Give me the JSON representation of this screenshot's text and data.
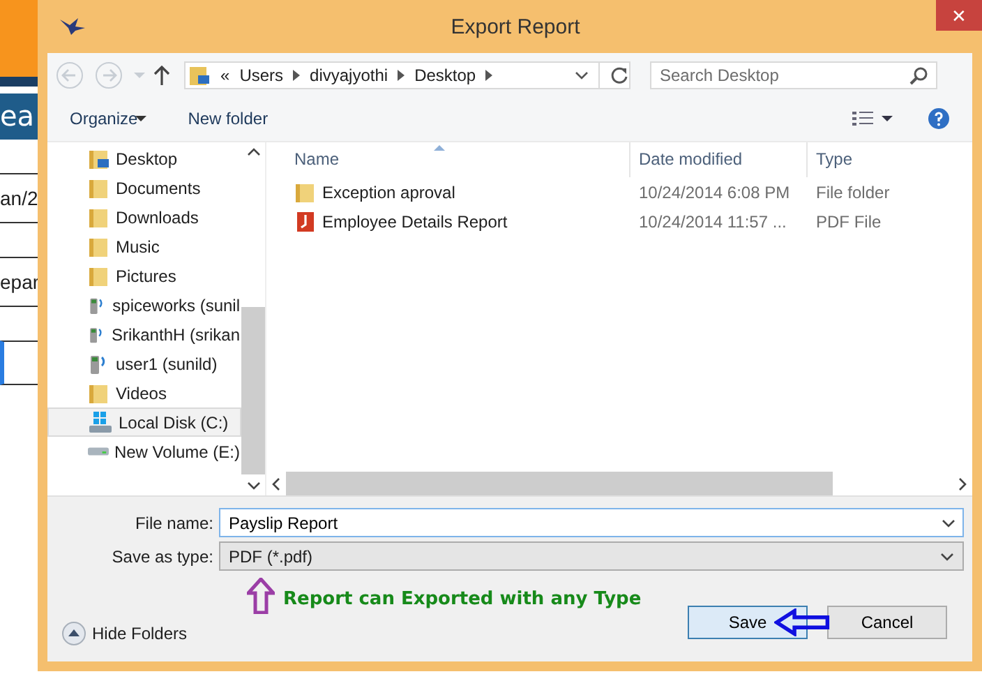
{
  "background_page": {
    "button_fragment": "ea",
    "field_fragments": [
      "an/2",
      "epar"
    ]
  },
  "window": {
    "title": "Export Report",
    "close": "✕"
  },
  "address": {
    "overflow": "«",
    "path": [
      "Users",
      "divyajyothi",
      "Desktop"
    ]
  },
  "search": {
    "placeholder": "Search Desktop"
  },
  "toolbar": {
    "organize": "Organize",
    "new_folder": "New folder"
  },
  "nav_tree": [
    {
      "label": "Desktop",
      "kind": "desktop",
      "selected": false
    },
    {
      "label": "Documents",
      "kind": "folder",
      "selected": false
    },
    {
      "label": "Downloads",
      "kind": "folder",
      "selected": false
    },
    {
      "label": "Music",
      "kind": "folder",
      "selected": false
    },
    {
      "label": "Pictures",
      "kind": "folder",
      "selected": false
    },
    {
      "label": "spiceworks (sunil",
      "kind": "network",
      "selected": false
    },
    {
      "label": "SrikanthH (srikan",
      "kind": "network",
      "selected": false
    },
    {
      "label": "user1 (sunild)",
      "kind": "network",
      "selected": false
    },
    {
      "label": "Videos",
      "kind": "folder",
      "selected": false
    },
    {
      "label": "Local Disk (C:)",
      "kind": "system-drive",
      "selected": true
    },
    {
      "label": "New Volume (E:)",
      "kind": "drive",
      "selected": false
    }
  ],
  "columns": [
    "Name",
    "Date modified",
    "Type"
  ],
  "files": [
    {
      "name": "Exception aproval",
      "kind": "folder",
      "date": "10/24/2014 6:08 PM",
      "type": "File folder"
    },
    {
      "name": "Employee Details Report",
      "kind": "pdf",
      "date": "10/24/2014 11:57 ...",
      "type": "PDF File"
    }
  ],
  "file_name": {
    "label": "File name:",
    "value": "Payslip Report"
  },
  "save_type": {
    "label": "Save as type:",
    "value": "PDF (*.pdf)"
  },
  "annotation": "Report can Exported with any Type",
  "hide_folders": "Hide Folders",
  "buttons": [
    "Save",
    "Cancel"
  ]
}
